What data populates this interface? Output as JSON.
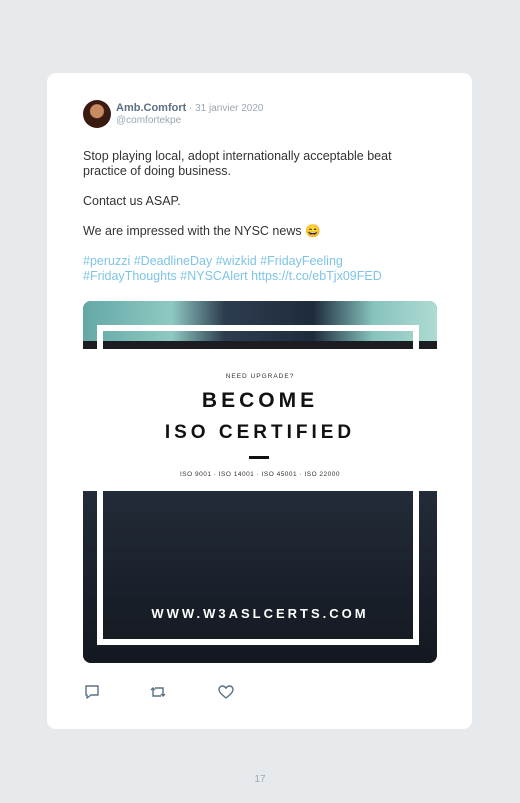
{
  "tweet": {
    "display_name": "Amb.Comfort",
    "date": "· 31 janvier 2020",
    "handle": "@comfortekpe",
    "paragraph_1": "Stop playing local, adopt internationally acceptable beat practice of doing business.",
    "paragraph_2": "Contact us ASAP.",
    "paragraph_3": "We are impressed with the NYSC news 😄",
    "hashtags": "#peruzzi #DeadlineDay #wizkid #FridayFeeling #FridayThoughts #NYSCAlert https://t.co/ebTjx09FED",
    "link_color": "#7ec4e6"
  },
  "media": {
    "kicker": "NEED UPGRADE?",
    "headline_1": "BECOME",
    "headline_2": "ISO CERTIFIED",
    "standards": "ISO 9001 · ISO 14001 · ISO 45001 · ISO 22000",
    "website": "WWW.W3ASLCERTS.COM"
  },
  "actions": {
    "icons": [
      "reply-icon",
      "retweet-icon",
      "like-icon"
    ]
  },
  "page": {
    "number": "17"
  }
}
